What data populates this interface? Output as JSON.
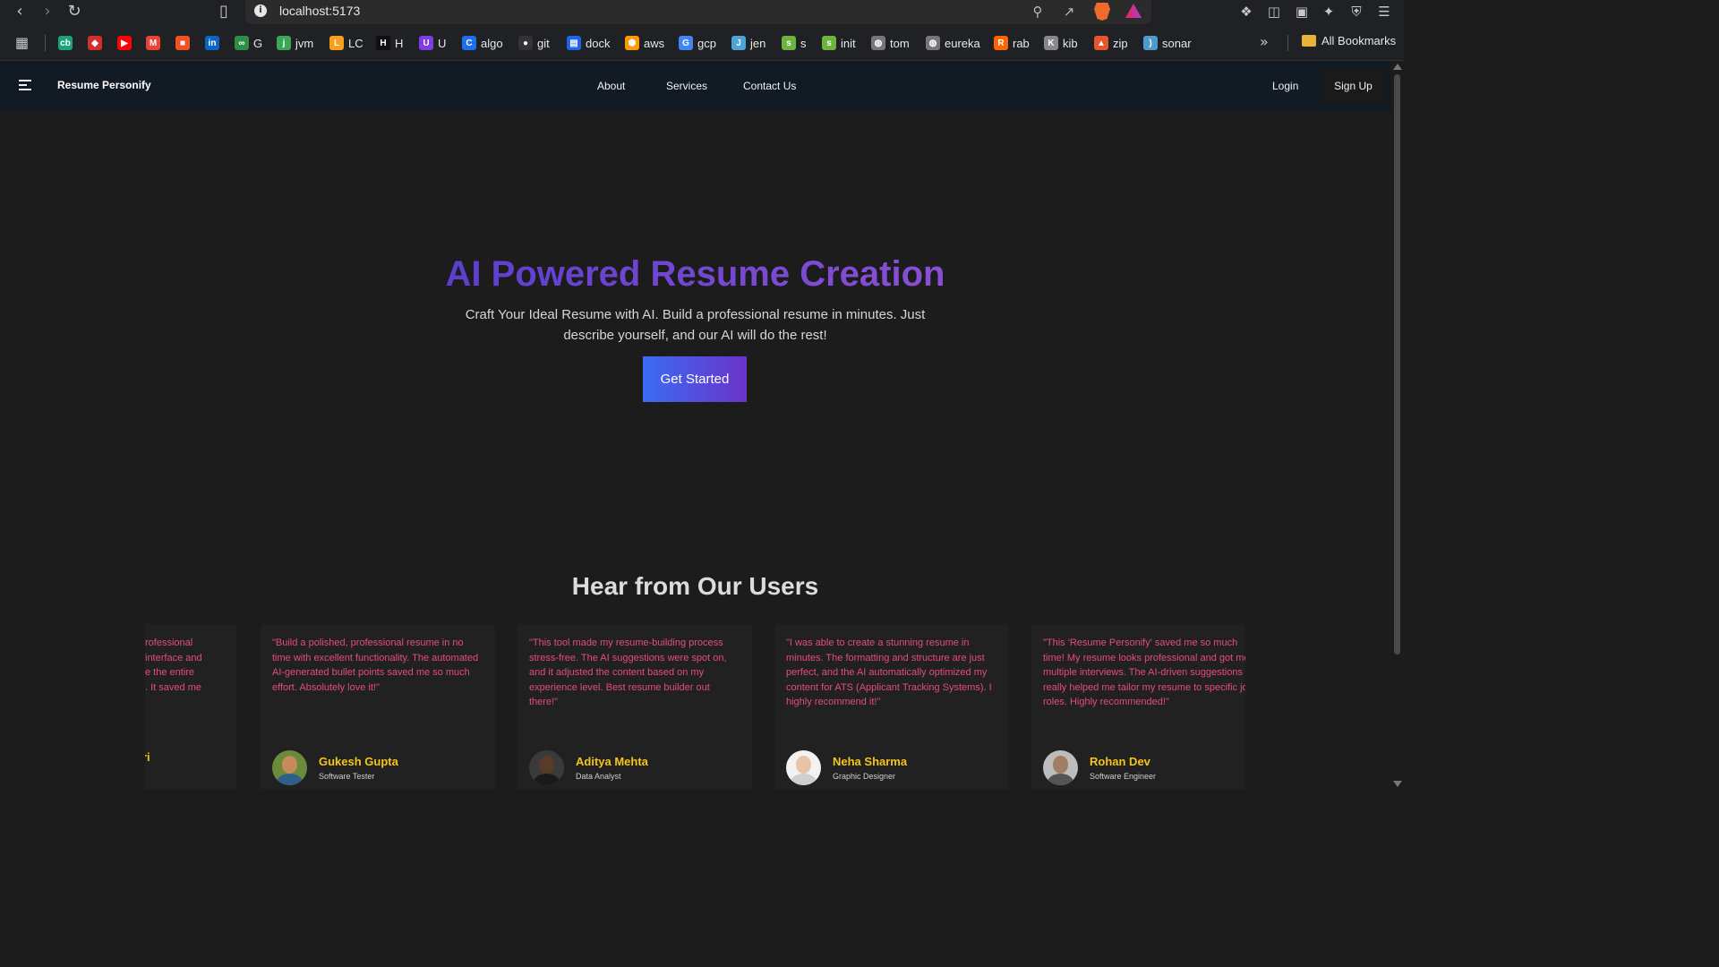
{
  "browser": {
    "url": "localhost:5173",
    "all_bookmarks": "All Bookmarks",
    "bookmarks": [
      {
        "label": "",
        "icon": "cb-icon",
        "color": "#1aa37a"
      },
      {
        "label": "",
        "icon": "diamond-icon",
        "color": "#d32f2f"
      },
      {
        "label": "",
        "icon": "youtube-icon",
        "color": "#ff0000"
      },
      {
        "label": "",
        "icon": "gmail-icon",
        "color": "#ea4335"
      },
      {
        "label": "",
        "icon": "microsoft-icon",
        "color": "#f25022"
      },
      {
        "label": "",
        "icon": "linkedin-icon",
        "color": "#0a66c2"
      },
      {
        "label": "G",
        "icon": "gfg-icon",
        "color": "#2f8d46"
      },
      {
        "label": "jvm",
        "icon": "jvm-icon",
        "color": "#3aa657"
      },
      {
        "label": "LC",
        "icon": "leetcode-icon",
        "color": "#f89f1b"
      },
      {
        "label": "H",
        "icon": "hackerrank-icon",
        "color": "#111111"
      },
      {
        "label": "U",
        "icon": "u-icon",
        "color": "#7b3fe4"
      },
      {
        "label": "algo",
        "icon": "c-icon",
        "color": "#1f6feb"
      },
      {
        "label": "git",
        "icon": "github-icon",
        "color": "#333333"
      },
      {
        "label": "dock",
        "icon": "docker-icon",
        "color": "#1d63ed"
      },
      {
        "label": "aws",
        "icon": "aws-icon",
        "color": "#ff9900"
      },
      {
        "label": "gcp",
        "icon": "google-icon",
        "color": "#4285f4"
      },
      {
        "label": "jen",
        "icon": "jenkins-icon",
        "color": "#4fa3d8"
      },
      {
        "label": "s",
        "icon": "spring-icon",
        "color": "#6db33f"
      },
      {
        "label": "init",
        "icon": "spring-init-icon",
        "color": "#6db33f"
      },
      {
        "label": "tom",
        "icon": "globe-icon",
        "color": "#777777"
      },
      {
        "label": "eureka",
        "icon": "globe-icon",
        "color": "#777777"
      },
      {
        "label": "rab",
        "icon": "rabbitmq-icon",
        "color": "#ff6600"
      },
      {
        "label": "kib",
        "icon": "kibana-icon",
        "color": "#888888"
      },
      {
        "label": "zip",
        "icon": "zipkin-icon",
        "color": "#e4572e"
      },
      {
        "label": "sonar",
        "icon": "sonar-icon",
        "color": "#4e9bcd"
      }
    ]
  },
  "nav": {
    "brand": "Resume Personify",
    "links": [
      "About",
      "Services",
      "Contact Us"
    ],
    "login": "Login",
    "signup": "Sign Up"
  },
  "hero": {
    "title": "AI Powered Resume Creation",
    "subtitle": "Craft Your Ideal Resume with AI. Build a professional resume in minutes. Just describe yourself, and our AI will do the rest!",
    "cta": "Get Started"
  },
  "testimonials": {
    "title": "Hear from Our Users",
    "partial": {
      "quote": "rofessional\ninterface and\ne the entire\n. It saved me",
      "name": "ri"
    },
    "items": [
      {
        "quote": "\"Build a polished, professional resume in no time with excellent functionality. The automated AI-generated bullet points saved me so much effort. Absolutely love it!\"",
        "name": "Gukesh Gupta",
        "role": "Software Tester"
      },
      {
        "quote": "\"This tool made my resume-building process stress-free. The AI suggestions were spot on, and it adjusted the content based on my experience level. Best resume builder out there!\"",
        "name": "Aditya Mehta",
        "role": "Data Analyst"
      },
      {
        "quote": "\"I was able to create a stunning resume in minutes. The formatting and structure are just perfect, and the AI automatically optimized my content for ATS (Applicant Tracking Systems). I highly recommend it!\"",
        "name": "Neha Sharma",
        "role": "Graphic Designer"
      },
      {
        "quote": "\"This 'Resume Personify' saved me so much time! My resume looks professional and got me multiple interviews. The AI-driven suggestions really helped me tailor my resume to specific job roles. Highly recommended!\"",
        "name": "Rohan Dev",
        "role": "Software Engineer"
      }
    ]
  }
}
